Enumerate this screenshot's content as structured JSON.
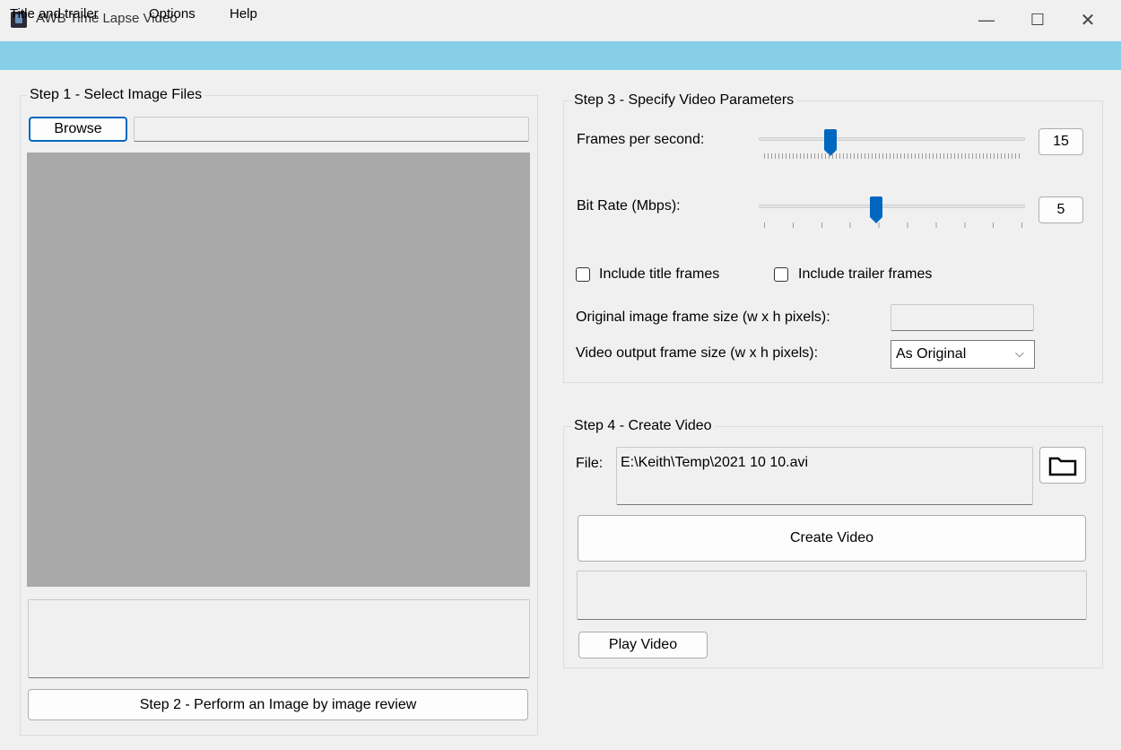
{
  "window": {
    "title": "AWB Time Lapse Video",
    "controls": {
      "minimize": "—",
      "maximize": "☐",
      "close": "✕"
    }
  },
  "menu": {
    "items": [
      "Title and trailer",
      "Options",
      "Help"
    ],
    "bg_color": "#87cee8"
  },
  "step1": {
    "label": "Step 1 - Select Image Files",
    "browse_label": "Browse",
    "path_value": "",
    "review_button": "Step 2 - Perform an Image by image review"
  },
  "step3": {
    "label": "Step 3 - Specify Video Parameters",
    "fps_label": "Frames per second:",
    "fps_value": "15",
    "fps_slider_fraction": 0.27,
    "bitrate_label": "Bit Rate (Mbps):",
    "bitrate_value": "5",
    "bitrate_slider_fraction": 0.44,
    "title_frames_label": "Include title frames",
    "title_frames_checked": false,
    "trailer_frames_label": "Include trailer frames",
    "trailer_frames_checked": false,
    "orig_size_label": "Original image frame size (w x h pixels):",
    "orig_size_value": "",
    "out_size_label": "Video output frame size (w x h pixels):",
    "out_size_selected": "As Original"
  },
  "step4": {
    "label": "Step 4 - Create Video",
    "file_label": "File:",
    "file_path": "E:\\Keith\\Temp\\2021 10 10.avi",
    "folder_icon": "folder-icon",
    "create_button": "Create Video",
    "play_button": "Play Video"
  },
  "colors": {
    "slider_thumb": "#0067c0",
    "image_area": "#a9a9a9"
  }
}
